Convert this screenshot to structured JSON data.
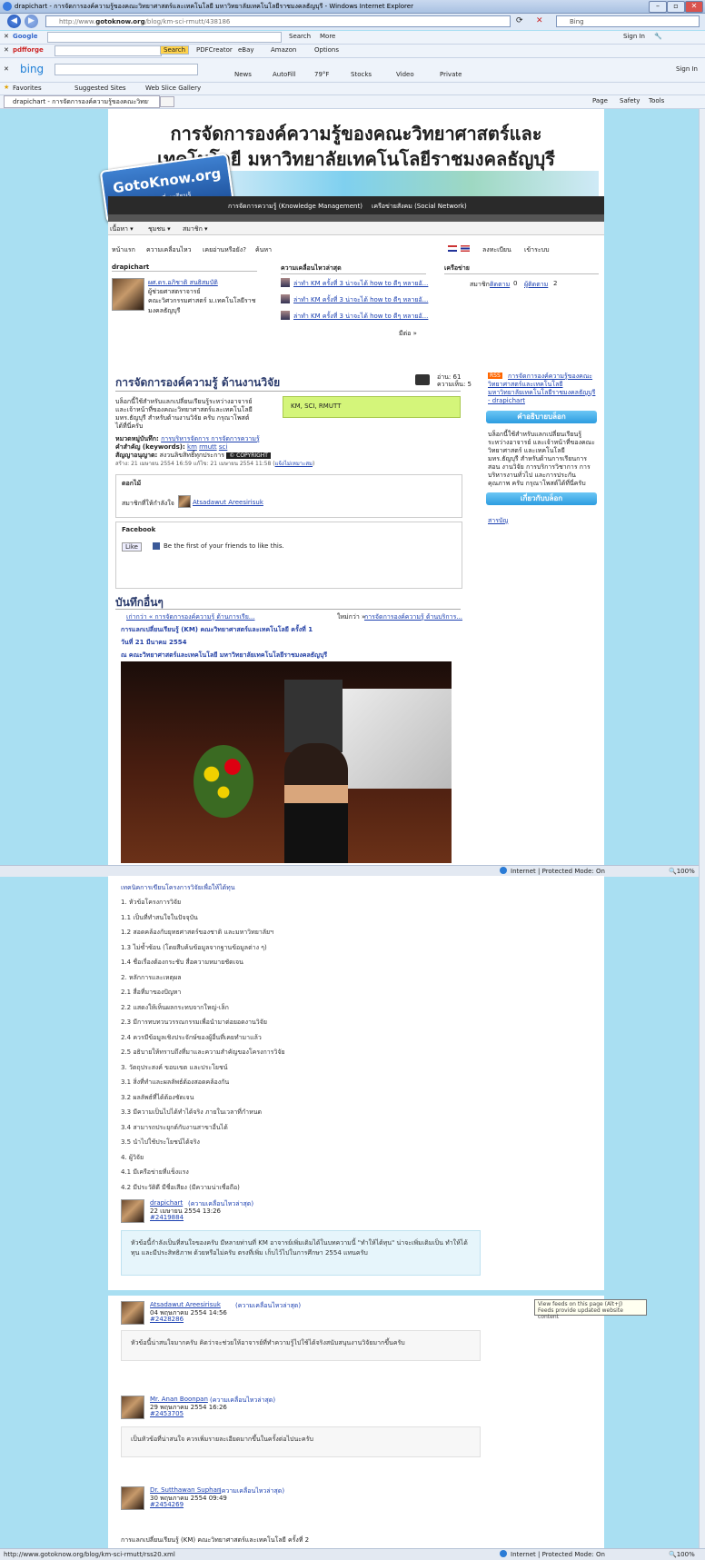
{
  "browser": {
    "window_title": "drapichart - การจัดการองค์ความรู้ของคณะวิทยาศาสตร์และเทคโนโลยี มหาวิทยาลัยเทคโนโลยีราชมงคลธัญบุรี - Windows Internet Explorer",
    "url_prefix": "http://www.",
    "url_domain": "gotoknow.org",
    "url_path": "/blog/km-sci-rmutt/438186",
    "bing_placeholder": "Bing",
    "google_label": "Google",
    "google_search": "Search",
    "google_more": "More",
    "sign_in": "Sign In",
    "pdf_label": "pdfforge",
    "pdf_search": "Search",
    "pdfcreator": "PDFCreator",
    "ebay": "eBay",
    "amazon": "Amazon",
    "options": "Options",
    "bing_label": "bing",
    "bing_icons": [
      "News",
      "AutoFill",
      "79°F",
      "Stocks",
      "Video",
      "Private"
    ],
    "favorites": "Favorites",
    "suggested_sites": "Suggested Sites",
    "web_slice": "Web Slice Gallery",
    "tab_title": "drapichart - การจัดการองค์ความรู้ของคณะวิทยาศาสตร์...",
    "cmd_page": "Page",
    "cmd_safety": "Safety",
    "cmd_tools": "Tools",
    "status_zone": "Internet | Protected Mode: On",
    "zoom": "100%",
    "status_url": "http://www.gotoknow.org/blog/km-sci-rmutt/rss20.xml",
    "tooltip_line1": "View feeds on this page (Alt+J)",
    "tooltip_line2": "Feeds provide updated website content"
  },
  "header": {
    "title_line1": "การจัดการองค์ความรู้ของคณะวิทยาศาสตร์และ",
    "title_line2": "เทคโนโลยี มหาวิทยาลัยเทคโนโลยีราชมงคลธัญบุรี",
    "logo_text": "GotoKnow.org",
    "logo_sub": "คนทำงานแลกเปลี่ยนเรียนรู้",
    "nav_km": "การจัดการความรู้ (Knowledge Management)",
    "nav_social": "เครือข่ายสังคม (Social Network)",
    "menu": [
      "เนื้อหา",
      "ชุมชน",
      "สมาชิก"
    ],
    "tabs": [
      "หน้าแรก",
      "ความเคลื่อนไหว",
      "เคยอ่านหรือยัง?",
      "ค้นหา"
    ],
    "register": "ลงทะเบียน",
    "login": "เข้าระบบ"
  },
  "profile": {
    "section_title": "drapichart",
    "name": "ผศ.ดร.อภิชาติ สนธิสมบัติ",
    "role": "ผู้ช่วยศาสตราจารย์",
    "org": "คณะวิศวกรรมศาสตร์ ม.เทคโนโลยีราช มงคลธัญบุรี",
    "recent_title": "ความเคลื่อนไหวล่าสุด",
    "recent": [
      "ล่าทำ KM ครั้งที่ 3 น่าจะได้ how to ดีๆ หลายอั...",
      "ล่าทำ KM ครั้งที่ 3 น่าจะได้ how to ดีๆ หลายอั...",
      "ล่าทำ KM ครั้งที่ 3 น่าจะได้ how to ดีๆ หลายอั..."
    ],
    "more": "มีต่อ »",
    "network_title": "เครือข่าย",
    "member_label": "สมาชิก",
    "following_label": "ติดตาม",
    "following_count": "0",
    "followers_label": "ผู้ติดตาม",
    "followers_count": "2"
  },
  "blog": {
    "title": "การจัดการองค์ความรู้ ด้านงานวิจัย",
    "reads": "อ่าน: 61",
    "comments": "ความเห็น: 5",
    "desc": "บล็อกนี้ใช้สำหรับแลกเปลี่ยนเรียนรู้ระหว่างอาจารย์ และเจ้าหน้าที่ของคณะวิทยาศาสตร์และเทคโนโลยี มทร.ธัญบุรี สำหรับด้านงานวิจัย ครับ กรุณาโพสต์ได้ที่นี่ครับ",
    "tags_box": "KM, SCI, RMUTT",
    "category_label": "หมวดหมู่บันทึก:",
    "category_value": "การบริหารจัดการ การจัดการความรู้",
    "keywords_label": "คำสำคัญ (keywords):",
    "keywords": [
      "km",
      "rmutt",
      "sci"
    ],
    "license_label": "สัญญาอนุญาต:",
    "license_value": "สงวนลิขสิทธิ์ทุกประการ",
    "copyright_badge": "© COPYRIGHT",
    "dates": "สร้าง: 21 เมษายน 2554 16:59 แก้ไข: 21 เมษายน 2554 11:58",
    "dates_link": "แจ้งไม่เหมาะสม",
    "flower_title": "ดอกไม้",
    "flower_text": "สมาชิกที่ให้กำลังใจ",
    "flower_user": "Atsadawut Areesirisuk",
    "facebook_title": "Facebook",
    "like": "Like",
    "fb_text": "Be the first of your friends to like this."
  },
  "sidebar": {
    "rss_badge": "RSS",
    "rss_link": "การจัดการองค์ความรู้ของคณะวิทยาศาสตร์และเทคโนโลยี มหาวิทยาลัยเทคโนโลยีราชมงคลธัญบุรี - drapichart",
    "about_button": "คำอธิบายบล็อก",
    "about_text": "บล็อกนี้ใช้สำหรับแลกเปลี่ยนเรียนรู้ระหว่างอาจารย์ และเจ้าหน้าที่ของคณะวิทยาศาสตร์ และเทคโนโลยี มทร.ธัญบุรี สำหรับด้านการเรียนการสอน งานวิจัย การบริการวิชาการ การบริหารงานทั่วไป และการประกันคุณภาพ ครับ กรุณาโพสต์ได้ที่นี่ครับ",
    "blog_button": "เกี่ยวกับบล็อก",
    "toc": "สารบัญ"
  },
  "post": {
    "others_title": "บันทึกอื่นๆ",
    "prev": "เก่ากว่า « การจัดการองค์ความรู้ ด้านการเรีย...",
    "next_label": "ใหม่กว่า »",
    "next": "การจัดการองค์ความรู้ ด้านบริการ...",
    "heading1": "การแลกเปลี่ยนเรียนรู้ (KM) คณะวิทยาศาสตร์และเทคโนโลยี ครั้งที่ 1",
    "heading2": "วันที่ 21 มีนาคม 2554",
    "heading3": "ณ คณะวิทยาศาสตร์และเทคโนโลยี มหาวิทยาลัยเทคโนโลยีราชมงคลธัญบุรี",
    "list_title": "เทคนิคการเขียนโครงการวิจัยเพื่อให้ได้ทุน",
    "items": [
      "1. หัวข้อโครงการวิจัย",
      "1.1 เป็นที่ทำสนใจในปัจจุบัน",
      "1.2 สอดคล้องกับยุทธศาสตร์ของชาติ และมหาวิทยาลัยฯ",
      "1.3 ไม่ซ้ำซ้อน (โดยสืบค้นข้อมูลจากฐานข้อมูลต่าง ๆ)",
      "1.4 ชื่อเรื่องต้องกระชับ สื่อความหมายชัดเจน",
      "2. หลักการและเหตุผล",
      "2.1 สื่อที่มาของปัญหา",
      "2.2 แสดงให้เห็นผลกระทบจากใหญ่-เล็ก",
      "2.3 มีการทบทวนวรรณกรรมเพื่อนำมาต่อยอดงานวิจัย",
      "2.4 ควรมีข้อมูลเชิงประจักษ์ของผู้อื่นที่เคยทำมาแล้ว",
      "2.5 อธิบายให้ทราบถึงที่มาและความสำคัญของโครงการวิจัย",
      "3. วัตถุประสงค์ ขอบเขต และประโยชน์",
      "3.1 สิ่งที่ทำและผลลัพธ์ต้องสอดคล้องกัน",
      "3.2 ผลลัพธ์ที่ได้ต้องชัดเจน",
      "3.3 มีความเป็นไปได้ทำได้จริง ภายในเวลาที่กำหนด",
      "3.4 สามารถประยุกต์กับงานสาขาอื่นได้",
      "3.5 นำไปใช้ประโยชน์ได้จริง",
      "4. ผู้วิจัย",
      "4.1 มีเครือข่ายที่แข็งแรง",
      "4.2 มีประวัติดี มีชื่อเสียง (มีความน่าเชื่อถือ)"
    ]
  },
  "comments": [
    {
      "author": "drapichart",
      "tag": "(ความเคลื่อนไหวล่าสุด)",
      "date": "22 เมษายน 2554 13:26",
      "id": "#2419884",
      "text": "หัวข้อนี้กำลังเป็นที่สนใจของครับ มีหลายท่านที่ KM อาจารย์เพิ่มเติมได้ในบทความนี้ \"ทำให้ได้ทุน\" น่าจะเพิ่มเติมเป็น ทำให้ได้ทุน และมีประสิทธิภาพ ด้วยหรือไม่ครับ ตรงที่เพิ่ม เก็บไว้ไปในการศึกษา 2554 แทนครับ"
    },
    {
      "author": "Atsadawut Areesirisuk",
      "tag": "(ความเคลื่อนไหวล่าสุด)",
      "date": "04 พฤษภาคม 2554 14:56",
      "id": "#2428286",
      "text": "หัวข้อนี้น่าสนใจมากครับ คิดว่าจะช่วยให้อาจารย์ที่ทำความรู้ไปใช้ได้จริงสนับสนุนงานวิจัยมากขึ้นครับ"
    },
    {
      "author": "Mr. Anan Boonpan",
      "tag": "(ความเคลื่อนไหวล่าสุด)",
      "date": "29 พฤษภาคม 2554 16:26",
      "id": "#2453705",
      "text": "เป็นหัวข้อที่น่าสนใจ ควรเพิ่มรายละเอียดมากขึ้นในครั้งต่อไปนะครับ"
    },
    {
      "author": "Dr. Sutthawan Suphan",
      "tag": "(ความเคลื่อนไหวล่าสุด)",
      "date": "30 พฤษภาคม 2554 09:49",
      "id": "#2454269",
      "text": "การแลกเปลี่ยนเรียนรู้ (KM) คณะวิทยาศาสตร์และเทคโนโลยี ครั้งที่ 2"
    }
  ],
  "colors": {
    "page_bg": "#a9dff2",
    "accent_blue": "#2d9ce0",
    "link": "#1a3fb0",
    "tag_box": "#d4f57a",
    "header_bar": "#2a2a2a"
  }
}
